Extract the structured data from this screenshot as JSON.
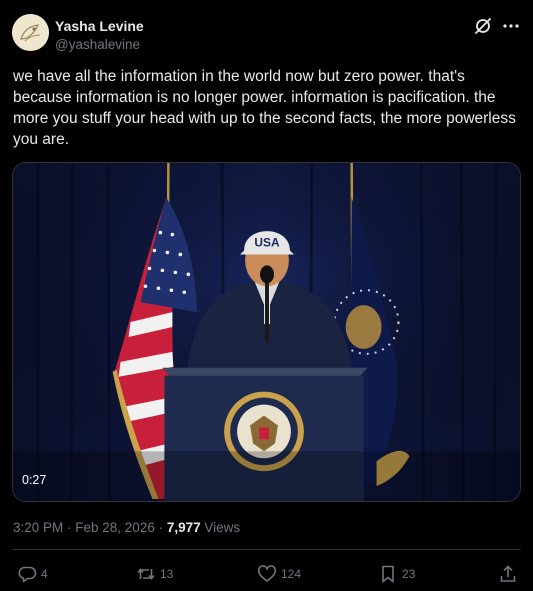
{
  "author": {
    "name": "Yasha Levine",
    "handle": "@yashalevine"
  },
  "post": {
    "text": "we have all the information in the world now but zero power. that's because information is no longer power. information is pacification. the more you stuff your head with up to the second facts, the more powerless you are."
  },
  "media": {
    "duration": "0:27",
    "cap_text": "USA"
  },
  "meta": {
    "time_date": "3:20 PM · Feb 28, 2026 · ",
    "views_count": "7,977",
    "views_label": " Views"
  },
  "actions": {
    "replies": "4",
    "reposts": "13",
    "likes": "124",
    "bookmarks": "23"
  },
  "colors": {
    "background": "#000000",
    "text": "#e7e9ea",
    "secondary": "#71767b",
    "border": "#2f3336"
  }
}
